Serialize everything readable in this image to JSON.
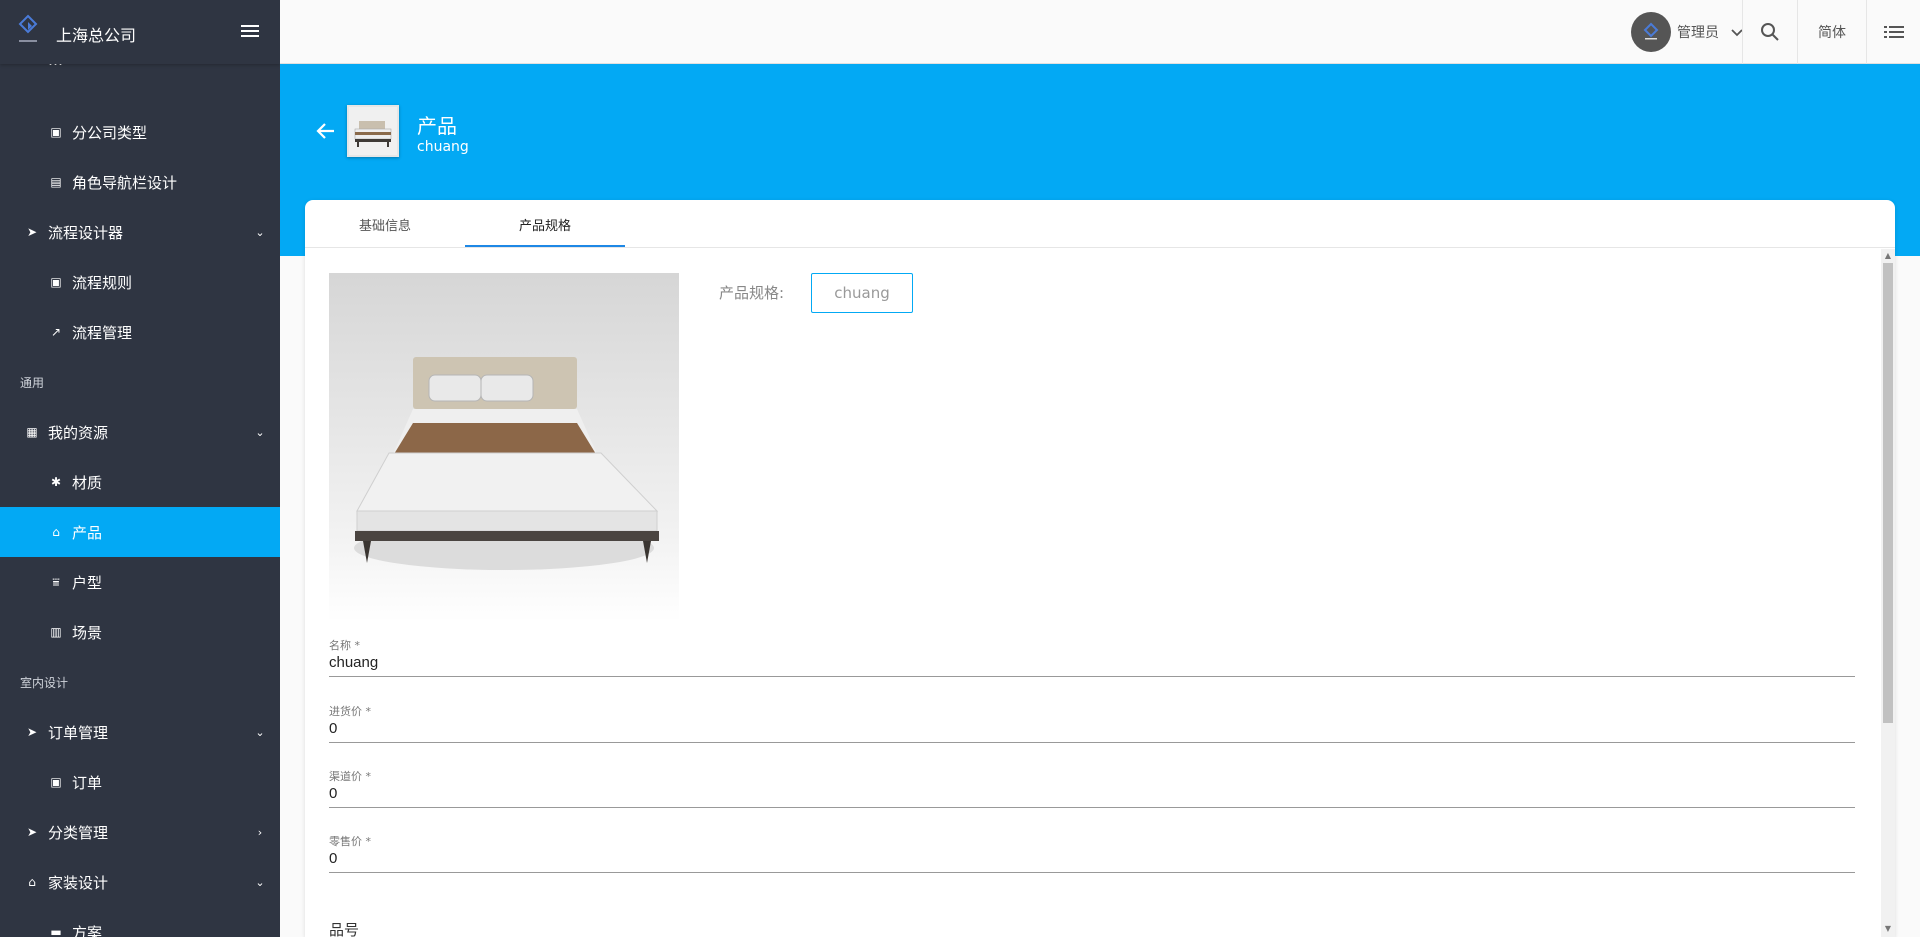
{
  "sidebar": {
    "company": "上海总公司",
    "partial_item": "…",
    "items": [
      {
        "label": "分公司类型",
        "icon": "clipboard-icon"
      },
      {
        "label": "角色导航栏设计",
        "icon": "book-icon"
      },
      {
        "label": "流程设计器",
        "icon": "label-icon"
      },
      {
        "label": "流程规则",
        "icon": "clipboard-icon"
      },
      {
        "label": "流程管理",
        "icon": "trending-up-icon"
      },
      {
        "label": "我的资源",
        "icon": "dashboard-icon"
      },
      {
        "label": "材质",
        "icon": "texture-icon"
      },
      {
        "label": "产品",
        "icon": "basket-icon"
      },
      {
        "label": "户型",
        "icon": "bank-icon"
      },
      {
        "label": "场景",
        "icon": "map-icon"
      },
      {
        "label": "订单管理",
        "icon": "label-icon"
      },
      {
        "label": "订单",
        "icon": "clipboard-icon"
      },
      {
        "label": "分类管理",
        "icon": "label-icon"
      },
      {
        "label": "家装设计",
        "icon": "home-icon"
      },
      {
        "label": "方案",
        "icon": "folder-icon"
      }
    ],
    "sections": {
      "general": "通用",
      "interior": "室内设计"
    }
  },
  "topbar": {
    "user": "管理员",
    "language": "简体"
  },
  "header": {
    "title": "产品",
    "subtitle": "chuang"
  },
  "tabs": [
    {
      "label": "基础信息"
    },
    {
      "label": "产品规格"
    }
  ],
  "spec": {
    "label": "产品规格:",
    "value": "chuang"
  },
  "fields": [
    {
      "label": "名称 *",
      "value": "chuang"
    },
    {
      "label": "进货价 *",
      "value": "0"
    },
    {
      "label": "渠道价 *",
      "value": "0"
    },
    {
      "label": "零售价 *",
      "value": "0"
    }
  ],
  "partial_field": "品号",
  "colors": {
    "primary": "#03a9f4",
    "sidebar": "#2f3542",
    "tab_ink": "#1e88e5"
  }
}
